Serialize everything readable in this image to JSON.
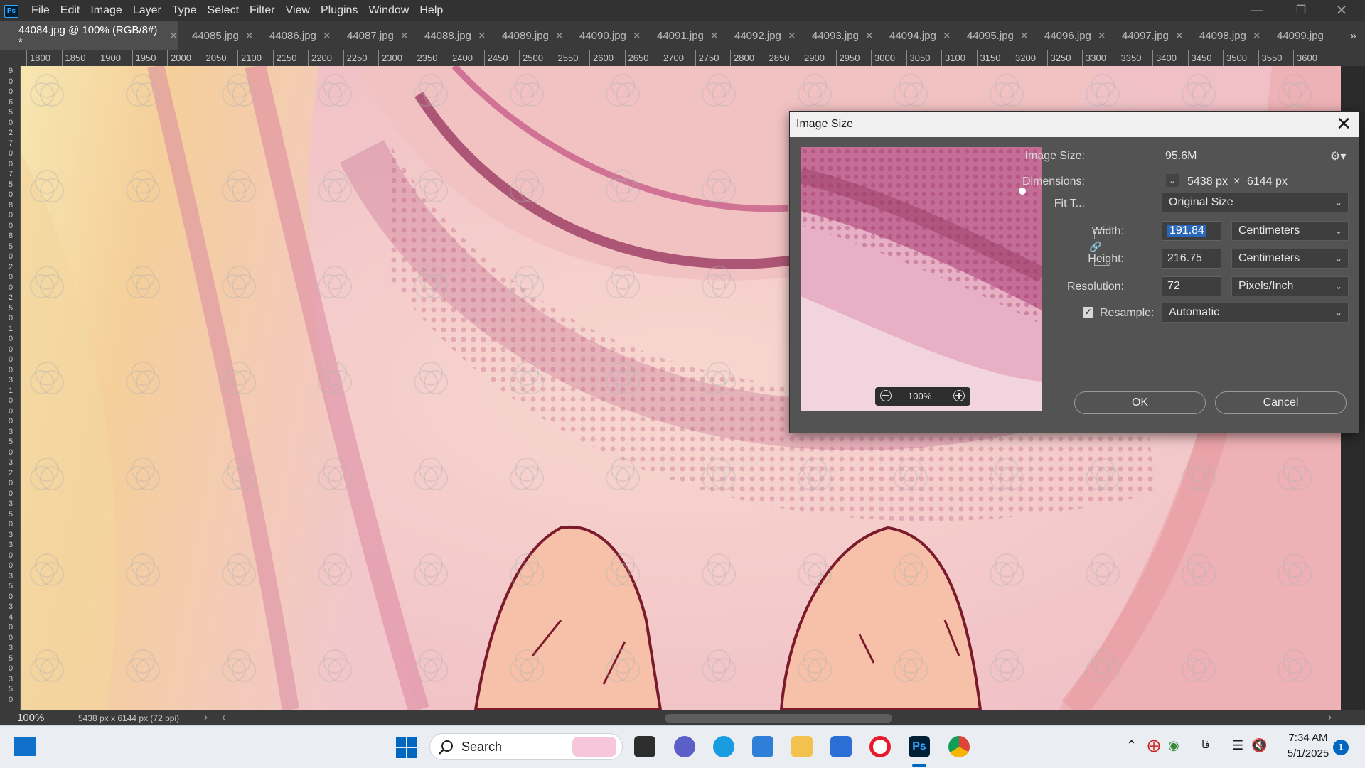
{
  "app": {
    "logo": "Ps",
    "menus": [
      "File",
      "Edit",
      "Image",
      "Layer",
      "Type",
      "Select",
      "Filter",
      "View",
      "Plugins",
      "Window",
      "Help"
    ]
  },
  "tabs": [
    {
      "label": "44084.jpg @ 100% (RGB/8#) *",
      "active": true
    },
    {
      "label": "44085.jpg"
    },
    {
      "label": "44086.jpg"
    },
    {
      "label": "44087.jpg"
    },
    {
      "label": "44088.jpg"
    },
    {
      "label": "44089.jpg"
    },
    {
      "label": "44090.jpg"
    },
    {
      "label": "44091.jpg"
    },
    {
      "label": "44092.jpg"
    },
    {
      "label": "44093.jpg"
    },
    {
      "label": "44094.jpg"
    },
    {
      "label": "44095.jpg"
    },
    {
      "label": "44096.jpg"
    },
    {
      "label": "44097.jpg"
    },
    {
      "label": "44098.jpg"
    },
    {
      "label": "44099.jpg"
    }
  ],
  "ruler": {
    "h_labels": [
      "1800",
      "1850",
      "1900",
      "1950",
      "2000",
      "2050",
      "2100",
      "2150",
      "2200",
      "2250",
      "2300",
      "2350",
      "2400",
      "2450",
      "2500",
      "2550",
      "2600",
      "2650",
      "2700",
      "2750",
      "2800",
      "2850",
      "2900",
      "2950",
      "3000",
      "3050",
      "3100",
      "3150",
      "3200",
      "3250",
      "3300",
      "3350",
      "3400",
      "3450",
      "3500",
      "3550",
      "3600"
    ],
    "v_digits": [
      "9",
      "0",
      "0",
      "6",
      "5",
      "0",
      "2",
      "7",
      "0",
      "0",
      "7",
      "5",
      "0",
      "8",
      "0",
      "0",
      "8",
      "5",
      "0",
      "2",
      "0",
      "0",
      "2",
      "5",
      "0",
      "1",
      "0",
      "0",
      "0",
      "0",
      "3",
      "1",
      "0",
      "0",
      "0",
      "3",
      "5",
      "0",
      "3",
      "2",
      "0",
      "0",
      "3",
      "5",
      "0",
      "3",
      "3",
      "0",
      "0",
      "3",
      "5",
      "0",
      "3",
      "4",
      "0",
      "0",
      "3",
      "5",
      "0",
      "3",
      "5",
      "0"
    ]
  },
  "status": {
    "zoom": "100%",
    "doc_info": "5438 px x 6144 px (72 ppi)",
    "arrow": "›",
    "scroll_left": "‹",
    "scroll_right": "›"
  },
  "dialog": {
    "title": "Image Size",
    "image_size_label": "Image Size:",
    "image_size_value": "95.6M",
    "dimensions_label": "Dimensions:",
    "dim_width": "5438 px",
    "dim_x": "×",
    "dim_height": "6144 px",
    "fit_label": "Fit T...",
    "fit_value": "Original Size",
    "width_label": "Width:",
    "width_value": "191.84",
    "width_unit": "Centimeters",
    "height_label": "Height:",
    "height_value": "216.75",
    "height_unit": "Centimeters",
    "resolution_label": "Resolution:",
    "resolution_value": "72",
    "resolution_unit": "Pixels/Inch",
    "resample_label": "Resample:",
    "resample_checked": true,
    "resample_value": "Automatic",
    "preview_zoom": "100%",
    "ok_label": "OK",
    "cancel_label": "Cancel"
  },
  "taskbar": {
    "search_label": "Search",
    "time": "7:34 AM",
    "date": "5/1/2025",
    "notifications": "1",
    "lang": "فا"
  }
}
